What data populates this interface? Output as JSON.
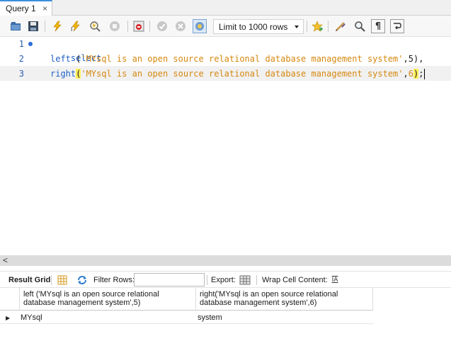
{
  "tabs": [
    {
      "label": "Query 1",
      "close": "×"
    }
  ],
  "toolbar": {
    "limit_select": "Limit to 1000 rows",
    "icons": [
      "open-folder-icon",
      "save-icon",
      "execute-icon",
      "execute-current-icon",
      "explain-icon",
      "stop-icon",
      "toggle-error-icon",
      "commit-icon",
      "rollback-icon",
      "autocommit-icon",
      "bookmark-star-icon",
      "beautify-icon",
      "find-icon",
      "invisible-chars-icon",
      "wrap-icon"
    ]
  },
  "editor": {
    "line_numbers": [
      "1",
      "2",
      "3"
    ],
    "lines": {
      "l1_kw": "select",
      "l2_kw": "left",
      "l2_open": " (",
      "l2_str": "'MYsql is an open source relational database management system'",
      "l2_rest": ",5),",
      "l3_kw": "right",
      "l3_open": "(",
      "l3_str": "'MYsql is an open source relational database management system'",
      "l3_comma": ",",
      "l3_num": "6",
      "l3_close": ")",
      "l3_semi": ";"
    }
  },
  "scrollbar": {
    "left_arrow": "<"
  },
  "result_toolbar": {
    "result_grid_label": "Result Grid",
    "filter_rows_label": "Filter Rows:",
    "filter_value": "",
    "export_label": "Export:",
    "wrap_label": "Wrap Cell Content:",
    "wrap_icon_glyph": "IA"
  },
  "grid": {
    "columns": [
      {
        "line1": "left ('MYsql is an open source relational",
        "line2": "database management system',5)"
      },
      {
        "line1": "right('MYsql is an open source relational",
        "line2": "database management system',6)"
      }
    ],
    "rows": [
      {
        "marker": "▶",
        "cells": [
          "MYsql",
          "system"
        ]
      }
    ]
  },
  "colors": {
    "keyword": "#1f60c8",
    "string": "#d6880f",
    "bracket_match": "#fff05a",
    "tab_accent": "#3c8fdc"
  }
}
